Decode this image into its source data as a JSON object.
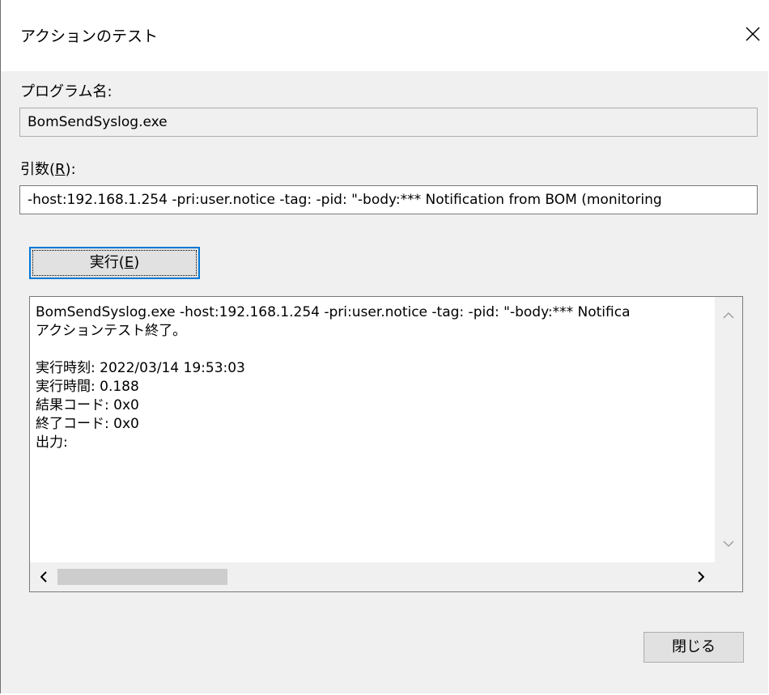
{
  "window": {
    "title": "アクションのテスト",
    "close_icon": "close-icon"
  },
  "program": {
    "label": "プログラム名:",
    "value": "BomSendSyslog.exe"
  },
  "args": {
    "label_prefix": "引数(",
    "label_accel": "R",
    "label_suffix": "):",
    "value": "-host:192.168.1.254 -pri:user.notice -tag: -pid: \"-body:*** Notification from BOM (monitoring"
  },
  "run_button": {
    "label_prefix": "実行(",
    "label_accel": "E",
    "label_suffix": ")"
  },
  "output": {
    "lines": [
      "BomSendSyslog.exe -host:192.168.1.254 -pri:user.notice -tag: -pid: \"-body:*** Notifica",
      "アクションテスト終了。",
      "",
      "実行時刻: 2022/03/14 19:53:03",
      "実行時間: 0.188",
      "結果コード: 0x0",
      "終了コード: 0x0",
      "出力:"
    ],
    "hscroll_position": 0.0
  },
  "close_button": {
    "label": "閉じる"
  }
}
